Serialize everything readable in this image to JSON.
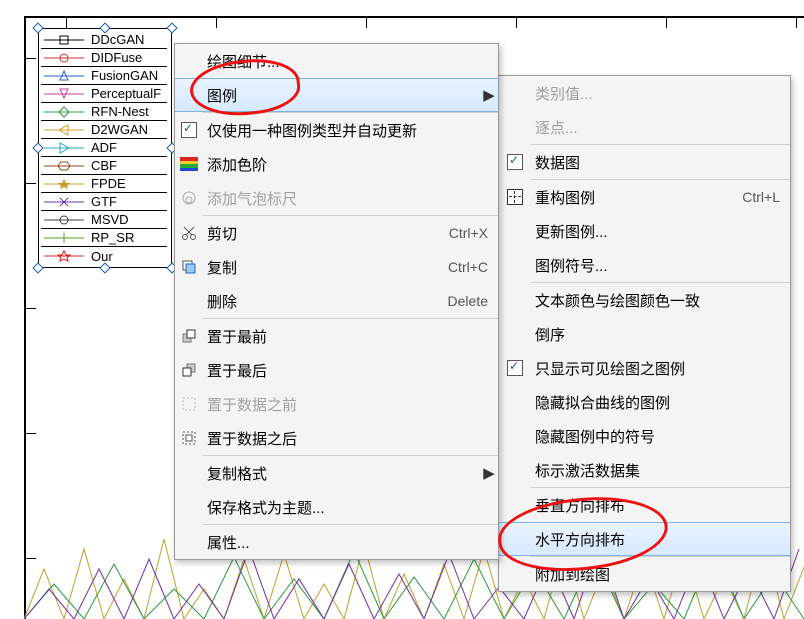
{
  "legend": {
    "items": [
      {
        "label": "DDcGAN",
        "color": "#000000",
        "marker": "square"
      },
      {
        "label": "DIDFuse",
        "color": "#d23232",
        "marker": "circle"
      },
      {
        "label": "FusionGAN",
        "color": "#2a63c8",
        "marker": "triangle"
      },
      {
        "label": "PerceptualF",
        "color": "#c83aa6",
        "marker": "triangle-solid"
      },
      {
        "label": "RFN-Nest",
        "color": "#2aa040",
        "marker": "diamond"
      },
      {
        "label": "D2WGAN",
        "color": "#d2a028",
        "marker": "tri-left"
      },
      {
        "label": "ADF",
        "color": "#2aa6c8",
        "marker": "tri-right"
      },
      {
        "label": "CBF",
        "color": "#8a4a1a",
        "marker": "hex"
      },
      {
        "label": "FPDE",
        "color": "#c8a028",
        "marker": "star-solid"
      },
      {
        "label": "GTF",
        "color": "#7030a0",
        "marker": "x"
      },
      {
        "label": "MSVD",
        "color": "#404040",
        "marker": "circle"
      },
      {
        "label": "RP_SR",
        "color": "#50a020",
        "marker": "plus"
      },
      {
        "label": "Our",
        "color": "#e22020",
        "marker": "star"
      }
    ]
  },
  "context_menu": {
    "plot_details": "绘图细节...",
    "legend": "图例",
    "use_one_legend": "仅使用一种图例类型并自动更新",
    "add_colorscale": "添加色阶",
    "add_bubble_ruler": "添加气泡标尺",
    "cut": "剪切",
    "cut_key": "Ctrl+X",
    "copy": "复制",
    "copy_key": "Ctrl+C",
    "delete": "删除",
    "delete_key": "Delete",
    "bring_front": "置于最前",
    "send_back": "置于最后",
    "before_data": "置于数据之前",
    "after_data": "置于数据之后",
    "copy_format": "复制格式",
    "save_format_theme": "保存格式为主题...",
    "properties": "属性..."
  },
  "submenu": {
    "categorical": "类别值...",
    "point_by_point": "逐点...",
    "data_plot": "数据图",
    "reconstruct": "重构图例",
    "reconstruct_key": "Ctrl+L",
    "update_legend": "更新图例...",
    "legend_symbol": "图例符号...",
    "text_color_match": "文本颜色与绘图颜色一致",
    "reverse_order": "倒序",
    "show_visible_only": "只显示可见绘图之图例",
    "hide_fit_curve": "隐藏拟合曲线的图例",
    "hide_legend_symbol": "隐藏图例中的符号",
    "mark_active_dataset": "标示激活数据集",
    "arrange_vertical": "垂直方向排布",
    "arrange_horizontal": "水平方向排布",
    "attach_to_plot": "附加到绘图"
  }
}
